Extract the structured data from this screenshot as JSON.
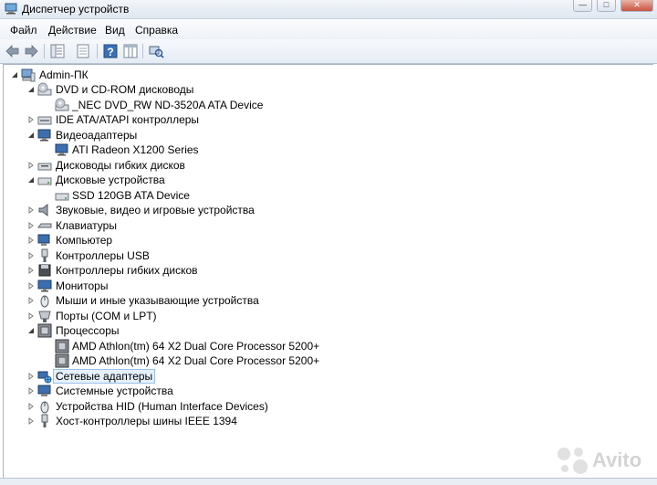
{
  "window": {
    "title": "Диспетчер устройств",
    "controls": [
      "—",
      "□",
      "✕"
    ]
  },
  "menu": [
    "Файл",
    "Действие",
    "Вид",
    "Справка"
  ],
  "toolbar": [
    "back-arrow-icon",
    "forward-arrow-icon",
    "tree-view-icon",
    "properties-icon",
    "help-icon",
    "columns-icon",
    "scan-hardware-icon"
  ],
  "tree": {
    "root": "Admin-ПК",
    "items": [
      {
        "label": "DVD и CD-ROM дисководы",
        "icon": "dvd-drive-icon",
        "expanded": true,
        "children": [
          {
            "label": "_NEC DVD_RW ND-3520A ATA Device",
            "icon": "dvd-drive-icon"
          }
        ]
      },
      {
        "label": "IDE ATA/ATAPI контроллеры",
        "icon": "ide-controller-icon",
        "expanded": false,
        "children": []
      },
      {
        "label": "Видеоадаптеры",
        "icon": "display-adapter-icon",
        "expanded": true,
        "children": [
          {
            "label": "ATI Radeon X1200 Series",
            "icon": "display-adapter-icon"
          }
        ]
      },
      {
        "label": "Дисководы гибких дисков",
        "icon": "floppy-drive-icon",
        "expanded": false,
        "children": []
      },
      {
        "label": "Дисковые устройства",
        "icon": "disk-drive-icon",
        "expanded": true,
        "children": [
          {
            "label": "SSD 120GB ATA Device",
            "icon": "disk-drive-icon"
          }
        ]
      },
      {
        "label": "Звуковые, видео и игровые устройства",
        "icon": "speaker-icon",
        "expanded": false,
        "children": []
      },
      {
        "label": "Клавиатуры",
        "icon": "keyboard-icon",
        "expanded": false,
        "children": []
      },
      {
        "label": "Компьютер",
        "icon": "computer-icon",
        "expanded": false,
        "children": []
      },
      {
        "label": "Контроллеры USB",
        "icon": "usb-icon",
        "expanded": false,
        "children": []
      },
      {
        "label": "Контроллеры гибких дисков",
        "icon": "floppy-controller-icon",
        "expanded": false,
        "children": []
      },
      {
        "label": "Мониторы",
        "icon": "monitor-icon",
        "expanded": false,
        "children": []
      },
      {
        "label": "Мыши и иные указывающие устройства",
        "icon": "mouse-icon",
        "expanded": false,
        "children": []
      },
      {
        "label": "Порты (COM и LPT)",
        "icon": "port-icon",
        "expanded": false,
        "children": []
      },
      {
        "label": "Процессоры",
        "icon": "processor-icon",
        "expanded": true,
        "children": [
          {
            "label": "AMD Athlon(tm) 64 X2 Dual Core Processor 5200+",
            "icon": "processor-icon"
          },
          {
            "label": "AMD Athlon(tm) 64 X2 Dual Core Processor 5200+",
            "icon": "processor-icon"
          }
        ]
      },
      {
        "label": "Сетевые адаптеры",
        "icon": "network-adapter-icon",
        "expanded": false,
        "selected": true,
        "children": []
      },
      {
        "label": "Системные устройства",
        "icon": "system-device-icon",
        "expanded": false,
        "children": []
      },
      {
        "label": "Устройства HID (Human Interface Devices)",
        "icon": "hid-icon",
        "expanded": false,
        "children": []
      },
      {
        "label": "Хост-контроллеры шины IEEE 1394",
        "icon": "ieee1394-icon",
        "expanded": false,
        "children": []
      }
    ]
  },
  "watermark": {
    "text": "Avito"
  }
}
